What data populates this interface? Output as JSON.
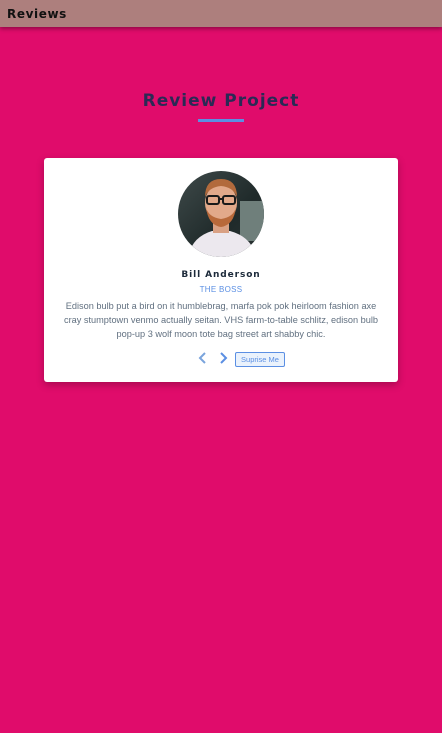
{
  "appbar": {
    "title": "Reviews"
  },
  "page": {
    "title": "Review Project"
  },
  "review": {
    "name": "Bill Anderson",
    "job": "THE BOSS",
    "text": "Edison bulb put a bird on it humblebrag, marfa pok pok heirloom fashion axe cray stumptown venmo actually seitan. VHS farm-to-table schlitz, edison bulb pop-up 3 wolf moon tote bag street art shabby chic.",
    "avatar_alt": "Bill Anderson"
  },
  "controls": {
    "prev_icon": "chevron-left-icon",
    "next_icon": "chevron-right-icon",
    "surprise_label": "Suprise Me"
  },
  "colors": {
    "background": "#e00c6b",
    "appbar": "#ad7f7d",
    "accent": "#5b8fe3",
    "title": "#2a2a55"
  }
}
